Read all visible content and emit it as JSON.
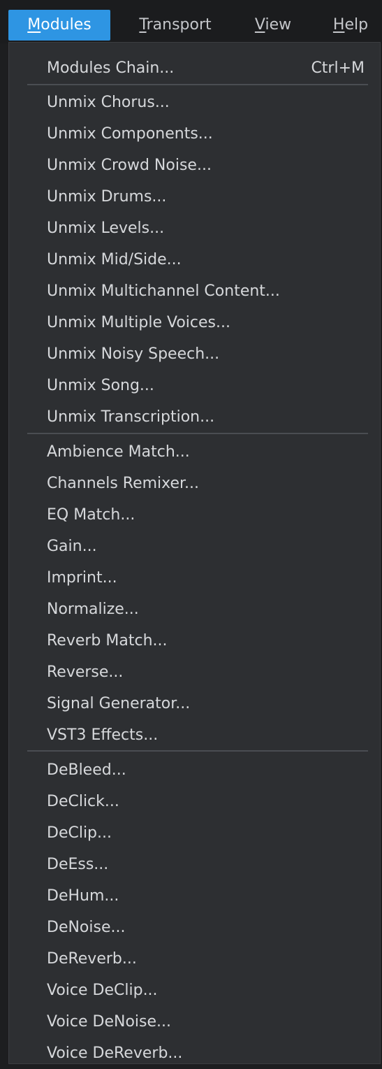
{
  "menubar": {
    "items": [
      {
        "label": "Modules",
        "mnemonic": "M",
        "rest": "odules",
        "active": true
      },
      {
        "label": "Transport",
        "mnemonic": "T",
        "rest": "ransport",
        "active": false
      },
      {
        "label": "View",
        "mnemonic": "V",
        "rest": "iew",
        "active": false
      },
      {
        "label": "Help",
        "mnemonic": "H",
        "rest": "elp",
        "active": false
      }
    ]
  },
  "colors": {
    "accent": "#2e95e3",
    "menu_bg": "#2d2f32",
    "text": "#d6d8db",
    "separator": "#4a4d52"
  },
  "modules_menu": {
    "chain": {
      "label": "Modules Chain...",
      "shortcut": "Ctrl+M"
    },
    "unmix": [
      "Unmix Chorus...",
      "Unmix Components...",
      "Unmix Crowd Noise...",
      "Unmix Drums...",
      "Unmix Levels...",
      "Unmix Mid/Side...",
      "Unmix Multichannel Content...",
      "Unmix Multiple Voices...",
      "Unmix Noisy Speech...",
      "Unmix Song...",
      "Unmix Transcription..."
    ],
    "processing": [
      "Ambience Match...",
      "Channels Remixer...",
      "EQ Match...",
      "Gain...",
      "Imprint...",
      "Normalize...",
      "Reverb Match...",
      "Reverse...",
      "Signal Generator...",
      "VST3 Effects..."
    ],
    "repair": [
      "DeBleed...",
      "DeClick...",
      "DeClip...",
      "DeEss...",
      "DeHum...",
      "DeNoise...",
      "DeReverb...",
      "Voice DeClip...",
      "Voice DeNoise...",
      "Voice DeReverb..."
    ]
  }
}
